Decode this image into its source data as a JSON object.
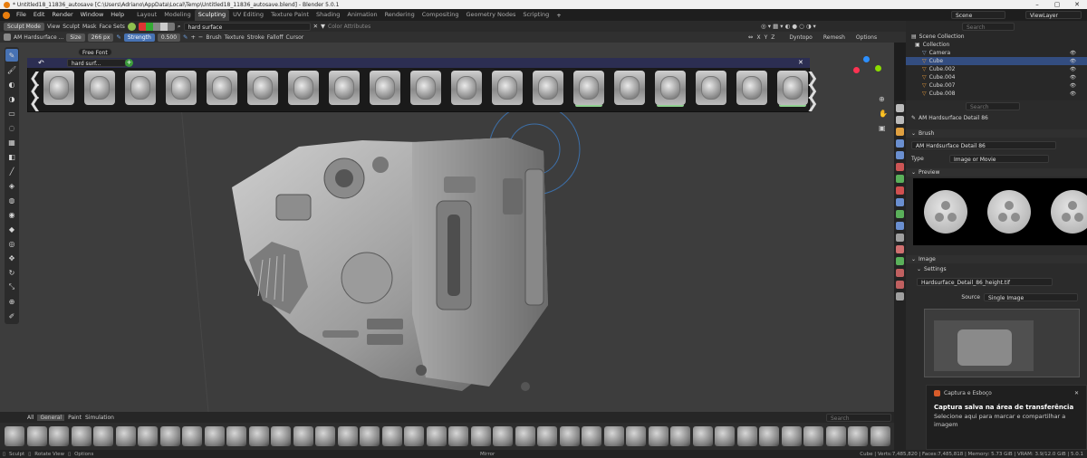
{
  "window": {
    "title": "* Untitled18_11836_autosave [C:\\Users\\Adriano\\AppData\\Local\\Temp\\Untitled18_11836_autosave.blend] - Blender 5.0.1"
  },
  "menu": {
    "items": [
      "File",
      "Edit",
      "Render",
      "Window",
      "Help"
    ],
    "workspaces": [
      "Layout",
      "Modeling",
      "Sculpting",
      "UV Editing",
      "Texture Paint",
      "Shading",
      "Animation",
      "Rendering",
      "Compositing",
      "Geometry Nodes",
      "Scripting"
    ],
    "scene_label": "Scene",
    "viewlayer_label": "ViewLayer"
  },
  "header": {
    "mode": "Sculpt Mode",
    "view": "View",
    "sculpt": "Sculpt",
    "mask": "Mask",
    "face_sets": "Face Sets",
    "search_value": "hard surface",
    "color_attributes": "Color Attributes"
  },
  "tool_header": {
    "brush_name": "AM Hardsurface ...",
    "size_label": "Size",
    "size_value": "266 px",
    "strength_label": "Strength",
    "strength_value": "0.500",
    "brush_menu": "Brush",
    "texture_menu": "Texture",
    "stroke_menu": "Stroke",
    "falloff_menu": "Falloff",
    "cursor_menu": "Cursor",
    "axes": [
      "X",
      "Y",
      "Z"
    ],
    "dyntopo": "Dyntopo",
    "remesh": "Remesh",
    "options": "Options"
  },
  "alpha_browser": {
    "search_value": "hard surf...",
    "filter_chip": "Free Font"
  },
  "bottom_tabs": [
    "All",
    "General",
    "Paint",
    "Simulation"
  ],
  "bottom_search_placeholder": "Search",
  "outliner": {
    "search_placeholder": "Search",
    "scene_collection": "Scene Collection",
    "collection": "Collection",
    "items": [
      "Camera",
      "Cube",
      "Cube.002",
      "Cube.004",
      "Cube.007",
      "Cube.008"
    ]
  },
  "properties": {
    "search_placeholder": "Search",
    "brush_name": "AM Hardsurface Detail 86",
    "brush_section": "Brush",
    "brush_field": "AM Hardsurface Detail 86",
    "type_label": "Type",
    "type_value": "Image or Movie",
    "preview_section": "Preview",
    "image_section": "Image",
    "settings_section": "Settings",
    "image_file": "Hardsurface_Detail_86_height.tif",
    "source_label": "Source",
    "source_value": "Single Image"
  },
  "toast": {
    "app": "Captura e Esboço",
    "title": "Captura salva na área de transferência",
    "body": "Selecione aqui para marcar e compartilhar a imagem"
  },
  "status": {
    "left": [
      "Sculpt",
      "Rotate View",
      "Options"
    ],
    "mirror": "Mirror",
    "stats": "Cube | Verts:7,485,820 | Faces:7,485,818 | Memory: 5.73 GiB | VRAM: 3.9/12.0 GiB | 5.0.1"
  },
  "colors": {
    "accent": "#4772b3",
    "selected_row": "#334d80",
    "alpha_header": "#2c2e52"
  }
}
